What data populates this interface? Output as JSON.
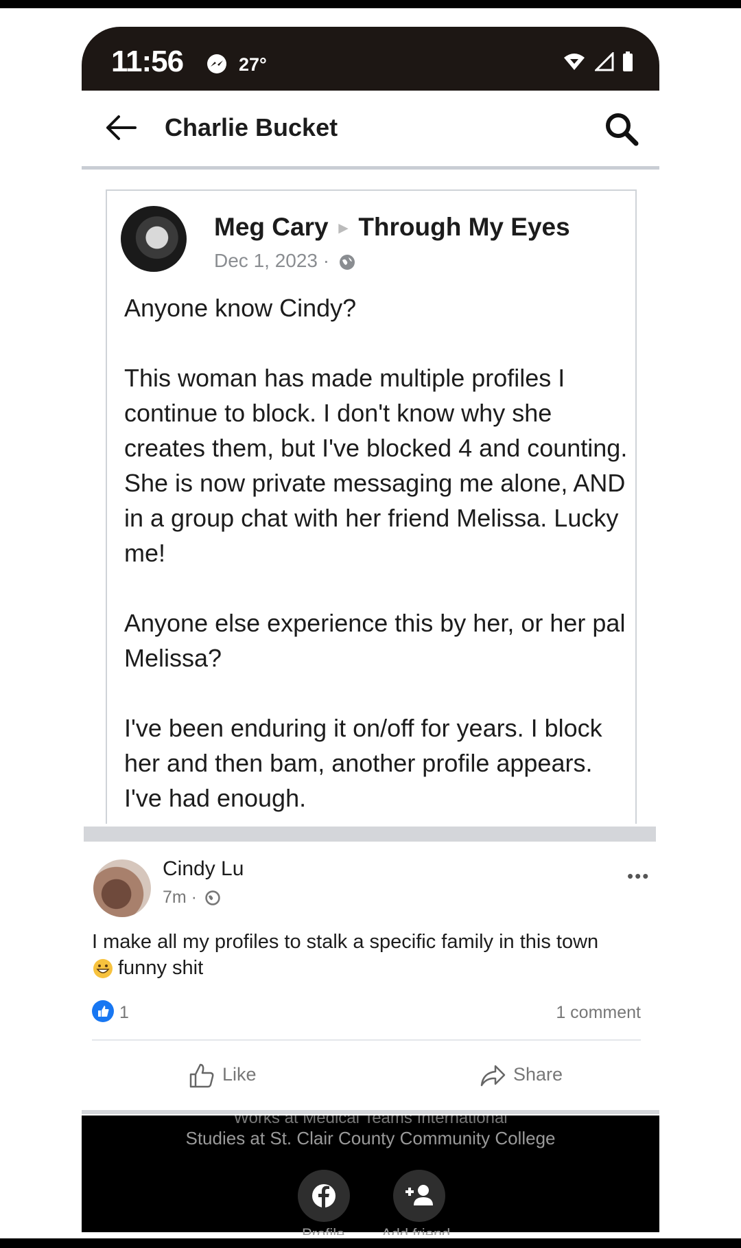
{
  "status_bar": {
    "time": "11:56",
    "temperature": "27°",
    "icons": [
      "messenger-icon",
      "wifi-icon",
      "signal-icon",
      "battery-icon"
    ]
  },
  "header": {
    "title": "Charlie Bucket",
    "back_icon": "back-arrow-icon",
    "search_icon": "search-icon"
  },
  "shared_post": {
    "author": "Meg Cary",
    "group": "Through My Eyes",
    "date": "Dec 1, 2023 ·",
    "paragraphs": [
      "Anyone know Cindy?",
      "This woman has made multiple profiles I continue to block. I don't know why she creates them, but I've blocked 4 and counting. She is now private messaging me alone, AND in a group chat with her friend Melissa. Lucky me!",
      "Anyone else experience this by her, or her pal Melissa?",
      "I've been enduring it on/off for years. I block her and then bam, another profile appears. I've had enough."
    ]
  },
  "comment": {
    "name": "Cindy Lu",
    "meta": "7m ·",
    "more": "•••",
    "text_line1": "I make all my profiles to stalk a specific family in this town",
    "text_line2": "funny shit",
    "likes": "1",
    "comments": "1 comment",
    "like_label": "Like",
    "share_label": "Share"
  },
  "profile_strip": {
    "works": "Works at Medical Teams International",
    "studies": "Studies at St. Clair County Community College",
    "profile_label": "Profile",
    "add_friend_label": "Add friend"
  },
  "colors": {
    "status_bar": "#1d1714",
    "like_blue": "#1877f2",
    "divider": "#d4d6da"
  }
}
